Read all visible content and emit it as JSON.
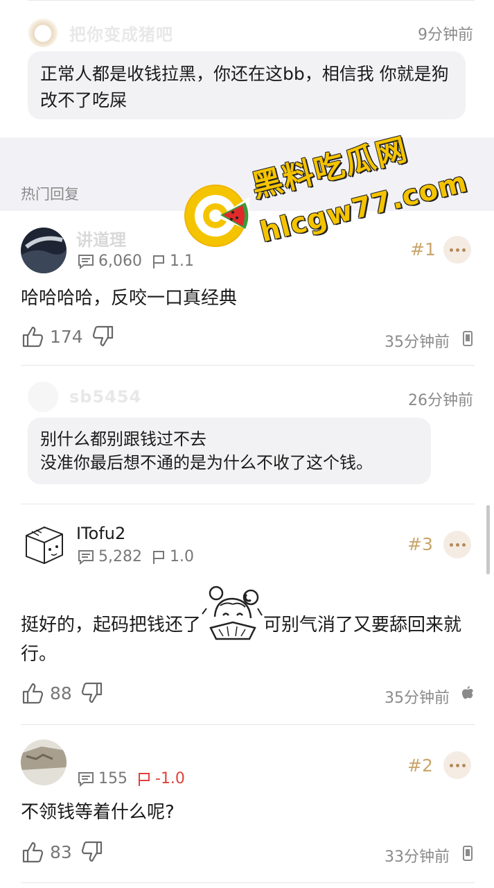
{
  "top_reply": {
    "username": "把你变成猪吧",
    "time": "9分钟前",
    "text": "正常人都是收钱拉黑，你还在这bb，相信我 你就是狗改不了吃屎"
  },
  "section_title": "热门回复",
  "watermark": {
    "brand": "黑料吃瓜网",
    "domain": "hlcgw77.com"
  },
  "comments": [
    {
      "username": "讲道理",
      "reply_count": "6,060",
      "score": "1.1",
      "floor": "#1",
      "text": "哈哈哈哈，反咬一口真经典",
      "likes": "174",
      "time": "35分钟前",
      "device": "phone-icon"
    },
    {
      "username": "ITofu2",
      "reply_count": "5,282",
      "score": "1.0",
      "floor": "#3",
      "text_before": "挺好的，起码把钱还了",
      "text_after": "可别气消了又要舔回来就行。",
      "likes": "88",
      "time": "35分钟前",
      "device": "apple-icon"
    },
    {
      "reply_count": "155",
      "score": "-1.0",
      "floor": "#2",
      "text": "不领钱等着什么呢?",
      "likes": "83",
      "time": "33分钟前",
      "device": "phone-icon"
    }
  ],
  "nested_reply": {
    "username": "sb5454",
    "time": "26分钟前",
    "line1": "别什么都别跟钱过不去",
    "line2": "没准你最后想不通的是为什么不收了这个钱。"
  },
  "colors": {
    "floor": "#c9a56b",
    "negative_score": "#e0413a",
    "bubble_bg": "#f2f2f4",
    "watermark_yellow": "#f5c400"
  }
}
